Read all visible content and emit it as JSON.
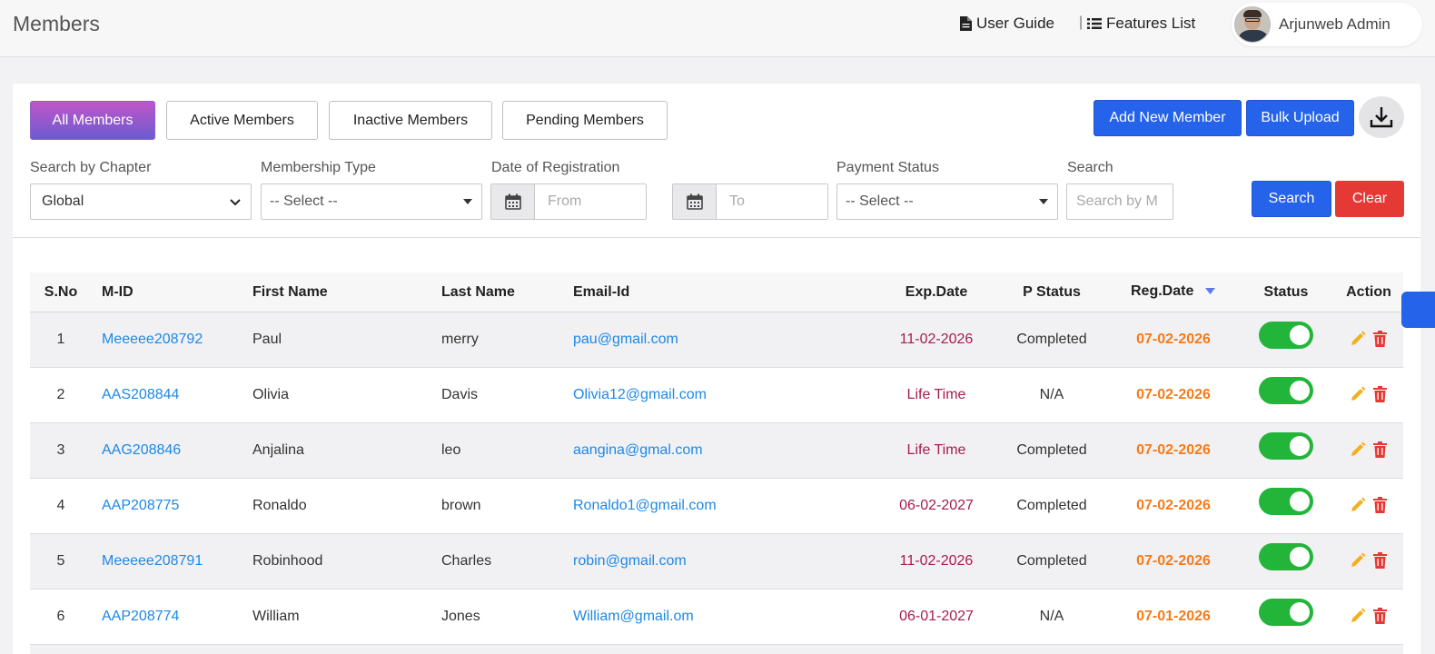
{
  "header": {
    "title": "Members",
    "user_guide": "User Guide",
    "separator": "|",
    "features_list": "Features List",
    "user_name": "Arjunweb Admin"
  },
  "tabs": [
    "All Members",
    "Active Members",
    "Inactive Members",
    "Pending Members"
  ],
  "actions": {
    "add_new": "Add New Member",
    "bulk_upload": "Bulk Upload"
  },
  "filters": {
    "chapter": {
      "label": "Search by Chapter",
      "value": "Global"
    },
    "membership": {
      "label": "Membership Type",
      "value": "-- Select --"
    },
    "registration": {
      "label": "Date of Registration",
      "from_placeholder": "From",
      "to_placeholder": "To"
    },
    "payment": {
      "label": "Payment Status",
      "value": "-- Select --"
    },
    "search": {
      "label": "Search",
      "placeholder": "Search by M"
    },
    "search_button": "Search",
    "clear_button": "Clear"
  },
  "table": {
    "headers": [
      "S.No",
      "M-ID",
      "First Name",
      "Last Name",
      "Email-Id",
      "Exp.Date",
      "P Status",
      "Reg.Date",
      "Status",
      "Action"
    ],
    "rows": [
      {
        "sno": "1",
        "mid": "Meeeee208792",
        "first": "Paul",
        "last": "merry",
        "email": "pau@gmail.com",
        "exp": "11-02-2026",
        "pstatus": "Completed",
        "reg": "07-02-2026",
        "active": true
      },
      {
        "sno": "2",
        "mid": "AAS208844",
        "first": "Olivia",
        "last": "Davis",
        "email": "Olivia12@gmail.com",
        "exp": "Life Time",
        "pstatus": "N/A",
        "reg": "07-02-2026",
        "active": true
      },
      {
        "sno": "3",
        "mid": "AAG208846",
        "first": "Anjalina",
        "last": "leo",
        "email": "aangina@gmal.com",
        "exp": "Life Time",
        "pstatus": "Completed",
        "reg": "07-02-2026",
        "active": true
      },
      {
        "sno": "4",
        "mid": "AAP208775",
        "first": "Ronaldo",
        "last": "brown",
        "email": "Ronaldo1@gmail.com",
        "exp": "06-02-2027",
        "pstatus": "Completed",
        "reg": "07-02-2026",
        "active": true
      },
      {
        "sno": "5",
        "mid": "Meeeee208791",
        "first": "Robinhood",
        "last": "Charles",
        "email": "robin@gmail.com",
        "exp": "11-02-2026",
        "pstatus": "Completed",
        "reg": "07-02-2026",
        "active": true
      },
      {
        "sno": "6",
        "mid": "AAP208774",
        "first": "William",
        "last": "Jones",
        "email": "William@gmail.om",
        "exp": "06-01-2027",
        "pstatus": "N/A",
        "reg": "07-01-2026",
        "active": true
      }
    ]
  },
  "colors": {
    "primary": "#2563eb",
    "danger": "#e53935",
    "link": "#1e88e5",
    "exp_date": "#a51d4b",
    "reg_date": "#f57b1a",
    "toggle_on": "#22b53a",
    "edit_icon": "#f2b01e"
  },
  "icons": [
    "document-icon",
    "list-icon",
    "download-icon",
    "calendar-icon",
    "sort-down-icon",
    "chevron-down-icon",
    "caret-down-icon",
    "edit-icon",
    "trash-icon"
  ]
}
